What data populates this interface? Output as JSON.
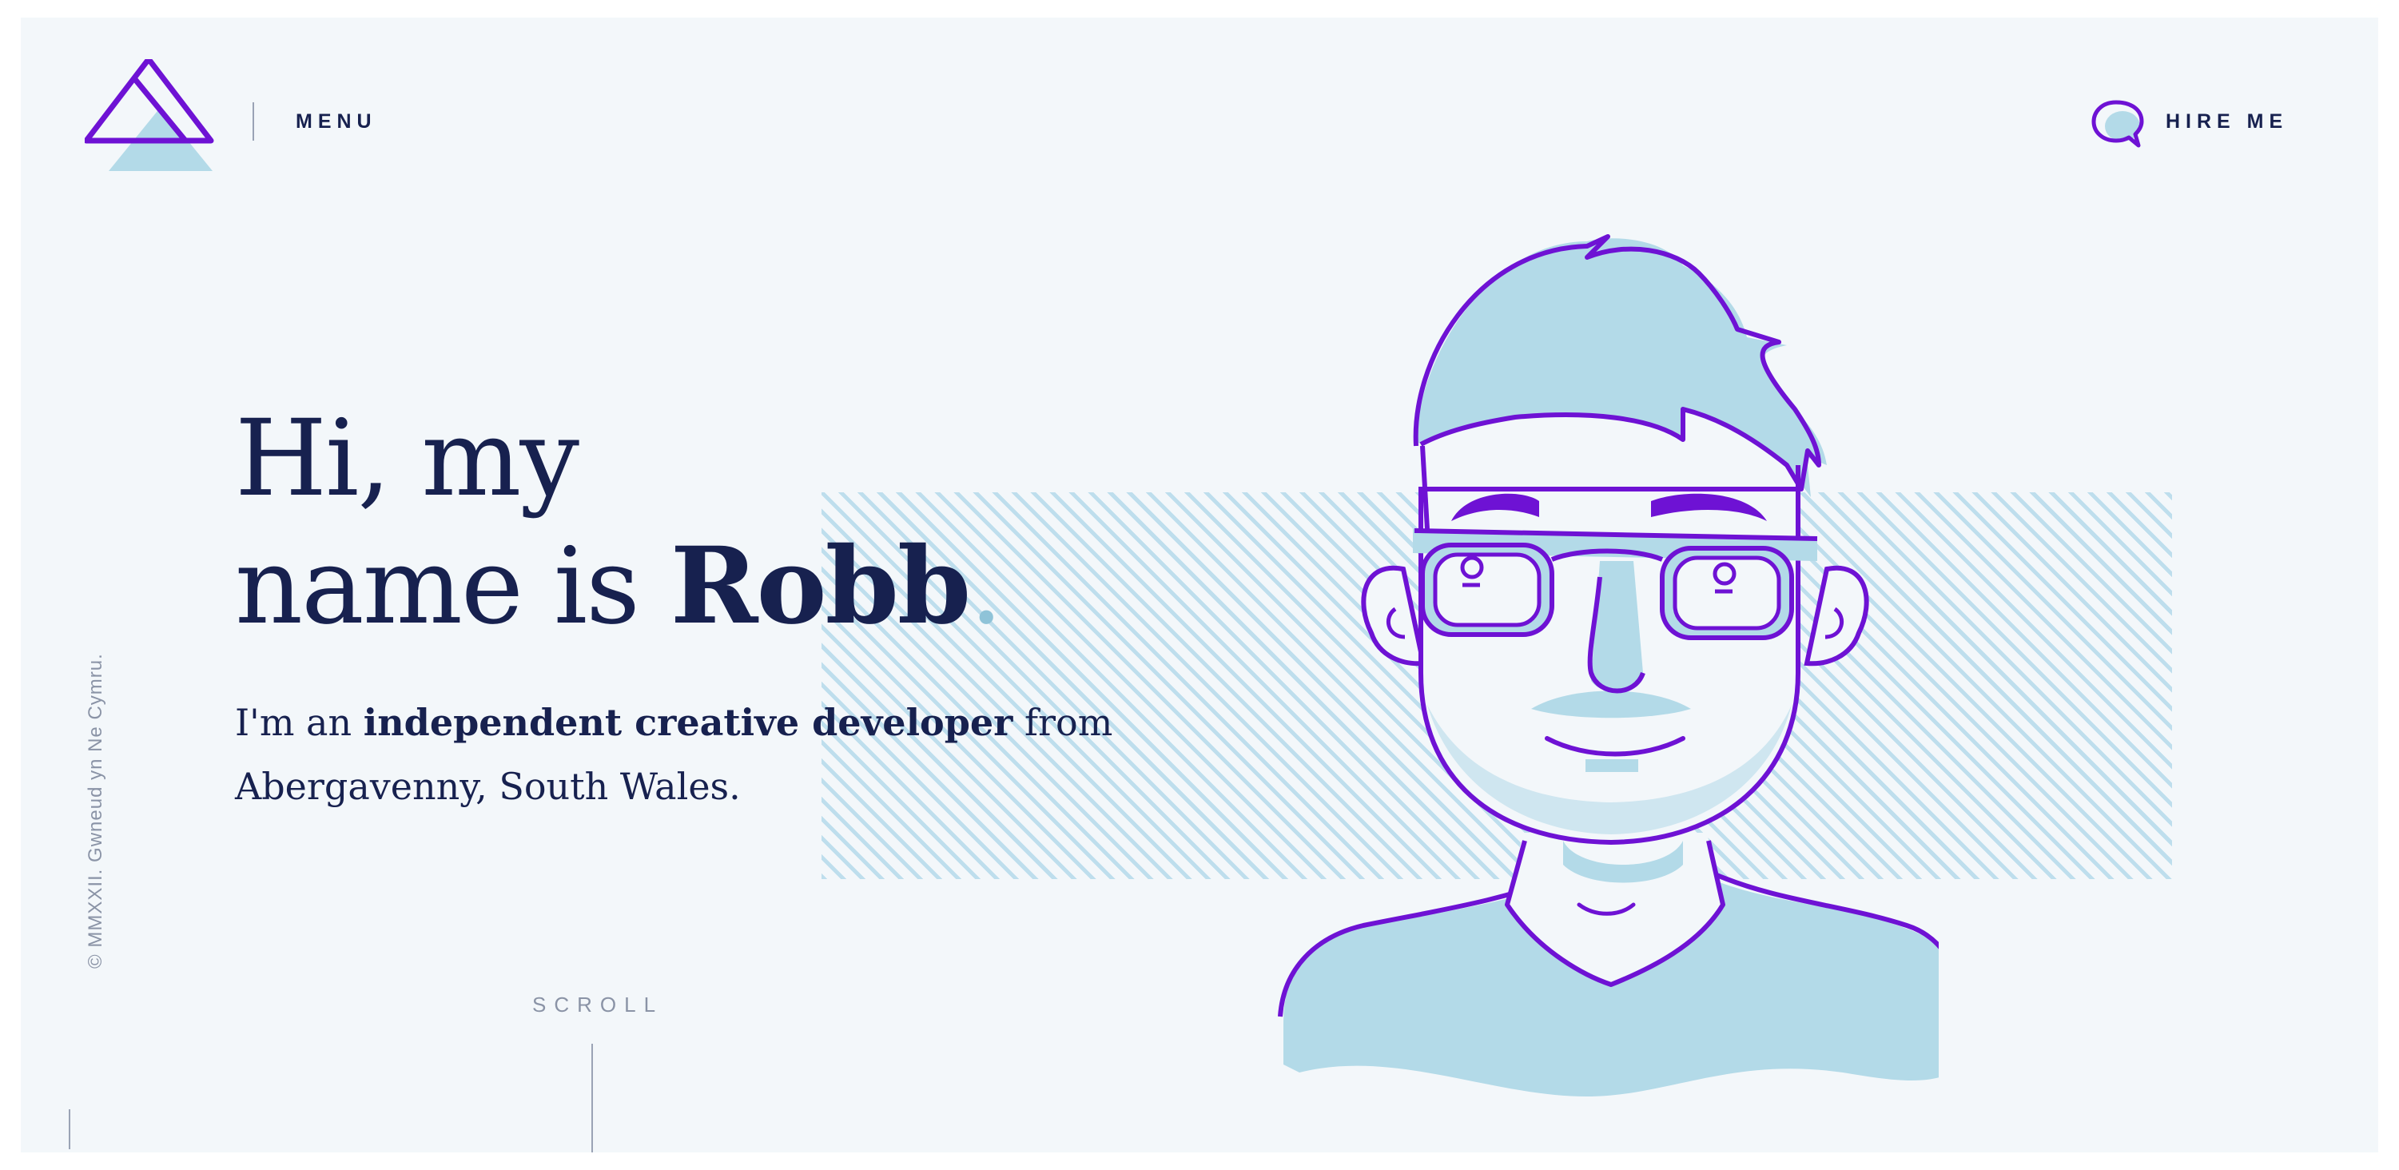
{
  "header": {
    "menu_label": "MENU",
    "hire_label": "HIRE ME"
  },
  "hero": {
    "headline_line1": "Hi, my",
    "headline_prefix": "name is ",
    "headline_name": "Robb",
    "headline_dot": ".",
    "intro_prefix": "I'm an ",
    "intro_bold": "independent creative developer",
    "intro_suffix": " from Abergavenny, South Wales."
  },
  "footer": {
    "scroll_label": "SCROLL",
    "copyright": "© MMXXII. Gwneud yn Ne Cymru."
  },
  "colors": {
    "navy": "#17214f",
    "purple": "#6e12d4",
    "light_blue": "#b3dae8",
    "background": "#f3f7fa"
  },
  "icons": [
    "logo-triangle-icon",
    "speech-bubble-icon"
  ]
}
